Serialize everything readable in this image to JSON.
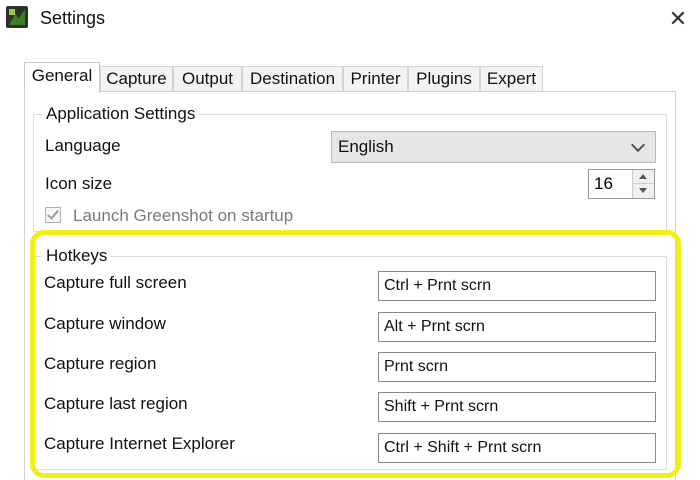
{
  "window": {
    "title": "Settings",
    "close_glyph": "✕",
    "icon": "greenshot-app-icon"
  },
  "tabs": [
    {
      "label": "General",
      "active": true
    },
    {
      "label": "Capture"
    },
    {
      "label": "Output"
    },
    {
      "label": "Destination"
    },
    {
      "label": "Printer"
    },
    {
      "label": "Plugins"
    },
    {
      "label": "Expert"
    }
  ],
  "application_settings": {
    "group_label": "Application Settings",
    "language_label": "Language",
    "language_value": "English",
    "icon_size_label": "Icon size",
    "icon_size_value": "16",
    "startup_label": "Launch Greenshot on startup",
    "startup_checked": true
  },
  "hotkeys": {
    "group_label": "Hotkeys",
    "items": [
      {
        "label": "Capture full screen",
        "value": "Ctrl + Prnt scrn"
      },
      {
        "label": "Capture window",
        "value": "Alt + Prnt scrn"
      },
      {
        "label": "Capture region",
        "value": "Prnt scrn"
      },
      {
        "label": "Capture last region",
        "value": "Shift + Prnt scrn"
      },
      {
        "label": "Capture Internet Explorer",
        "value": "Ctrl + Shift + Prnt scrn"
      }
    ]
  },
  "colors": {
    "highlight": "#f2ee1c",
    "select_bg": "#e6e6e6"
  }
}
